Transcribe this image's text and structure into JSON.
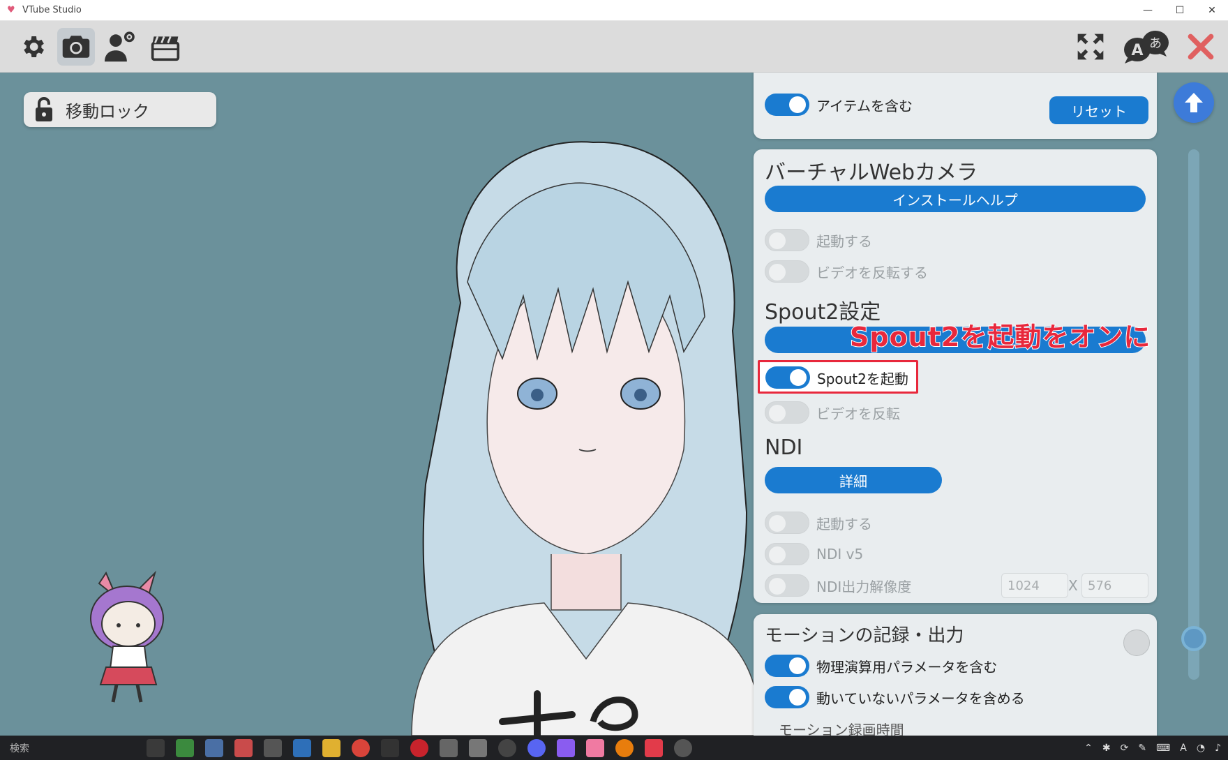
{
  "window": {
    "title": "VTube Studio",
    "controls": {
      "minimize": "—",
      "maximize": "☐",
      "close": "✕"
    }
  },
  "toolbar": {
    "left_icons": [
      "gear-icon",
      "camera-icon",
      "user-settings-icon",
      "clapperboard-icon"
    ],
    "active_icon": "camera-icon",
    "right_icons": [
      "fullscreen-icon",
      "language-icon",
      "close-x-icon"
    ],
    "language_glyphs": {
      "latin": "A",
      "japanese": "あ"
    }
  },
  "stage": {
    "lock_button_label": "移動ロック"
  },
  "panel_top": {
    "toggle_label": "アイテムを含む",
    "toggle_state": "on",
    "reset_label": "リセット"
  },
  "virtual_webcam": {
    "title": "バーチャルWebカメラ",
    "help_label": "インストールヘルプ",
    "toggles": [
      {
        "label": "起動する",
        "state": "off"
      },
      {
        "label": "ビデオを反転する",
        "state": "off"
      }
    ]
  },
  "spout2": {
    "title": "Spout2設定",
    "bar_label": "",
    "toggles": [
      {
        "label": "Spout2を起動",
        "state": "on"
      },
      {
        "label": "ビデオを反転",
        "state": "off"
      }
    ]
  },
  "ndi": {
    "title": "NDI",
    "detail_label": "詳細",
    "toggles": [
      {
        "label": "起動する",
        "state": "off"
      },
      {
        "label": "NDI v5",
        "state": "off"
      },
      {
        "label": "NDI出力解像度",
        "state": "off"
      }
    ],
    "width_placeholder": "1024",
    "x_label": "X",
    "height_placeholder": "576"
  },
  "motion": {
    "title": "モーションの記録・出力",
    "toggles": [
      {
        "label": "物理演算用パラメータを含む",
        "state": "on"
      },
      {
        "label": "動いていないパラメータを含める",
        "state": "on"
      }
    ],
    "next_label": "モーション録画時間"
  },
  "annotation": {
    "text": "Spout2を起動をオンに",
    "color": "#e8283c"
  },
  "taskbar": {
    "search_label": "検索",
    "tray_text": "A"
  },
  "colors": {
    "accent": "#1a7bd0",
    "stage_bg": "#6b919b",
    "highlight": "#e8283c"
  }
}
